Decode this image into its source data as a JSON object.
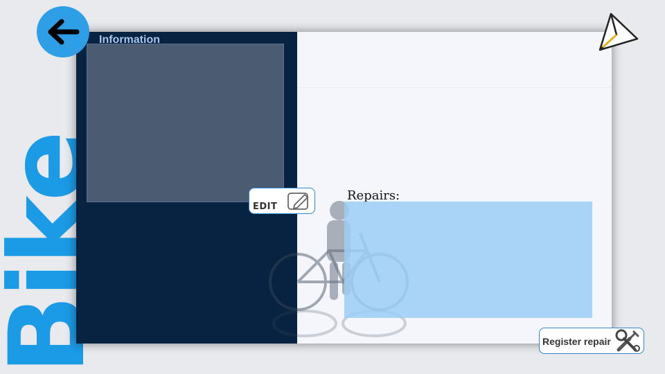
{
  "sidebar_word": "Bike",
  "info_panel": {
    "title": "Information"
  },
  "repairs": {
    "label": "Repairs:"
  },
  "buttons": {
    "edit_label": "EDIT",
    "register_label": "Register repair"
  },
  "icons": {
    "back": "arrow-left-icon",
    "send": "paper-plane-icon",
    "edit": "pencil-square-icon",
    "tools": "wrench-screwdriver-icon"
  },
  "colors": {
    "accent": "#1b9ae6",
    "panel_dark": "#082341",
    "repairs_box": "#9bcef6",
    "background": "#e8eaee"
  }
}
